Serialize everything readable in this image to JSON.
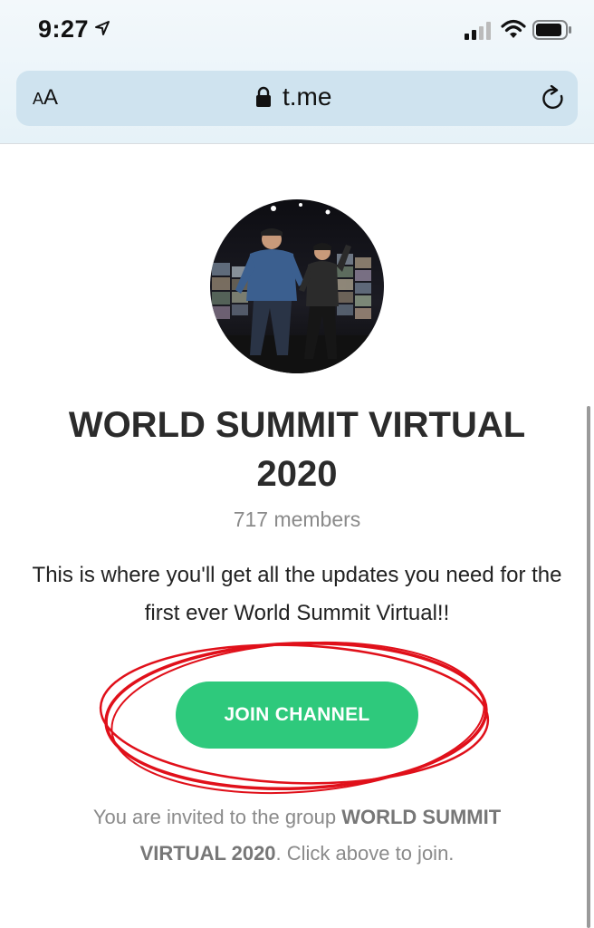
{
  "status_bar": {
    "time": "9:27",
    "icons": [
      "location-arrow-icon",
      "cellular-signal-icon",
      "wifi-icon",
      "battery-icon"
    ]
  },
  "browser": {
    "text_size_label_small": "A",
    "text_size_label_large": "A",
    "url": "t.me",
    "icons": [
      "lock-icon",
      "reload-icon"
    ]
  },
  "channel": {
    "title": "WORLD SUMMIT VIRTUAL 2020",
    "members": "717 members",
    "description": "This is where you'll get all the updates you need for the first ever World Summit Virtual!!",
    "join_label": "JOIN CHANNEL",
    "invite_prefix": "You are invited to the group ",
    "invite_group": "WORLD SUMMIT VIRTUAL 2020",
    "invite_suffix": ". Click above to join."
  },
  "colors": {
    "join_button": "#2ec97c",
    "annotation": "#e0101a",
    "address_bar": "#cfe3ef"
  }
}
